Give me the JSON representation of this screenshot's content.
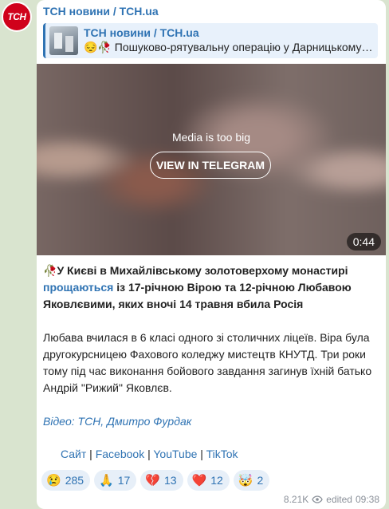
{
  "channel": {
    "avatar_text": "ТСН",
    "name": "ТСН новини / TCH.ua"
  },
  "reply": {
    "title": "ТСН новини / TCH.ua",
    "text": "😔🥀 Пошуково-рятувальну операцію у Дарницькому…"
  },
  "media": {
    "notice": "Media is too big",
    "button_label": "VIEW IN TELEGRAM",
    "duration": "0:44"
  },
  "caption": {
    "emoji": "🥀",
    "bold_1": "У Києві в Михайлівському золотоверхому монастирі ",
    "link": "прощаються",
    "bold_2": " із 17-річною Вірою та 12-річною Любавою Яковлєвими, яких вночі 14 травня вбила Росія",
    "paragraph": "Любава вчилася в 6 класі одного зі столичних ліцеїв. Віра була другокурсницею Фахового коледжу мистецтв КНУТД. Три роки тому під час виконання бойового завдання загинув їхній батько Андрій \"Рижий\" Яковлєв.",
    "credit": "Відео: ТСН, Дмитро Фурдак"
  },
  "links": {
    "site": "Сайт",
    "sep": " | ",
    "facebook": "Facebook",
    "youtube": "YouTube",
    "tiktok": "TikTok"
  },
  "reactions": [
    {
      "emoji": "😢",
      "count": "285"
    },
    {
      "emoji": "🙏",
      "count": "17"
    },
    {
      "emoji": "💔",
      "count": "13"
    },
    {
      "emoji": "❤️",
      "count": "12"
    },
    {
      "emoji": "🤯",
      "count": "2"
    }
  ],
  "meta": {
    "views": "8.21K",
    "edited": "edited",
    "time": "09:38"
  },
  "colors": {
    "accent": "#2f73b3",
    "brand_red": "#d0021b"
  }
}
